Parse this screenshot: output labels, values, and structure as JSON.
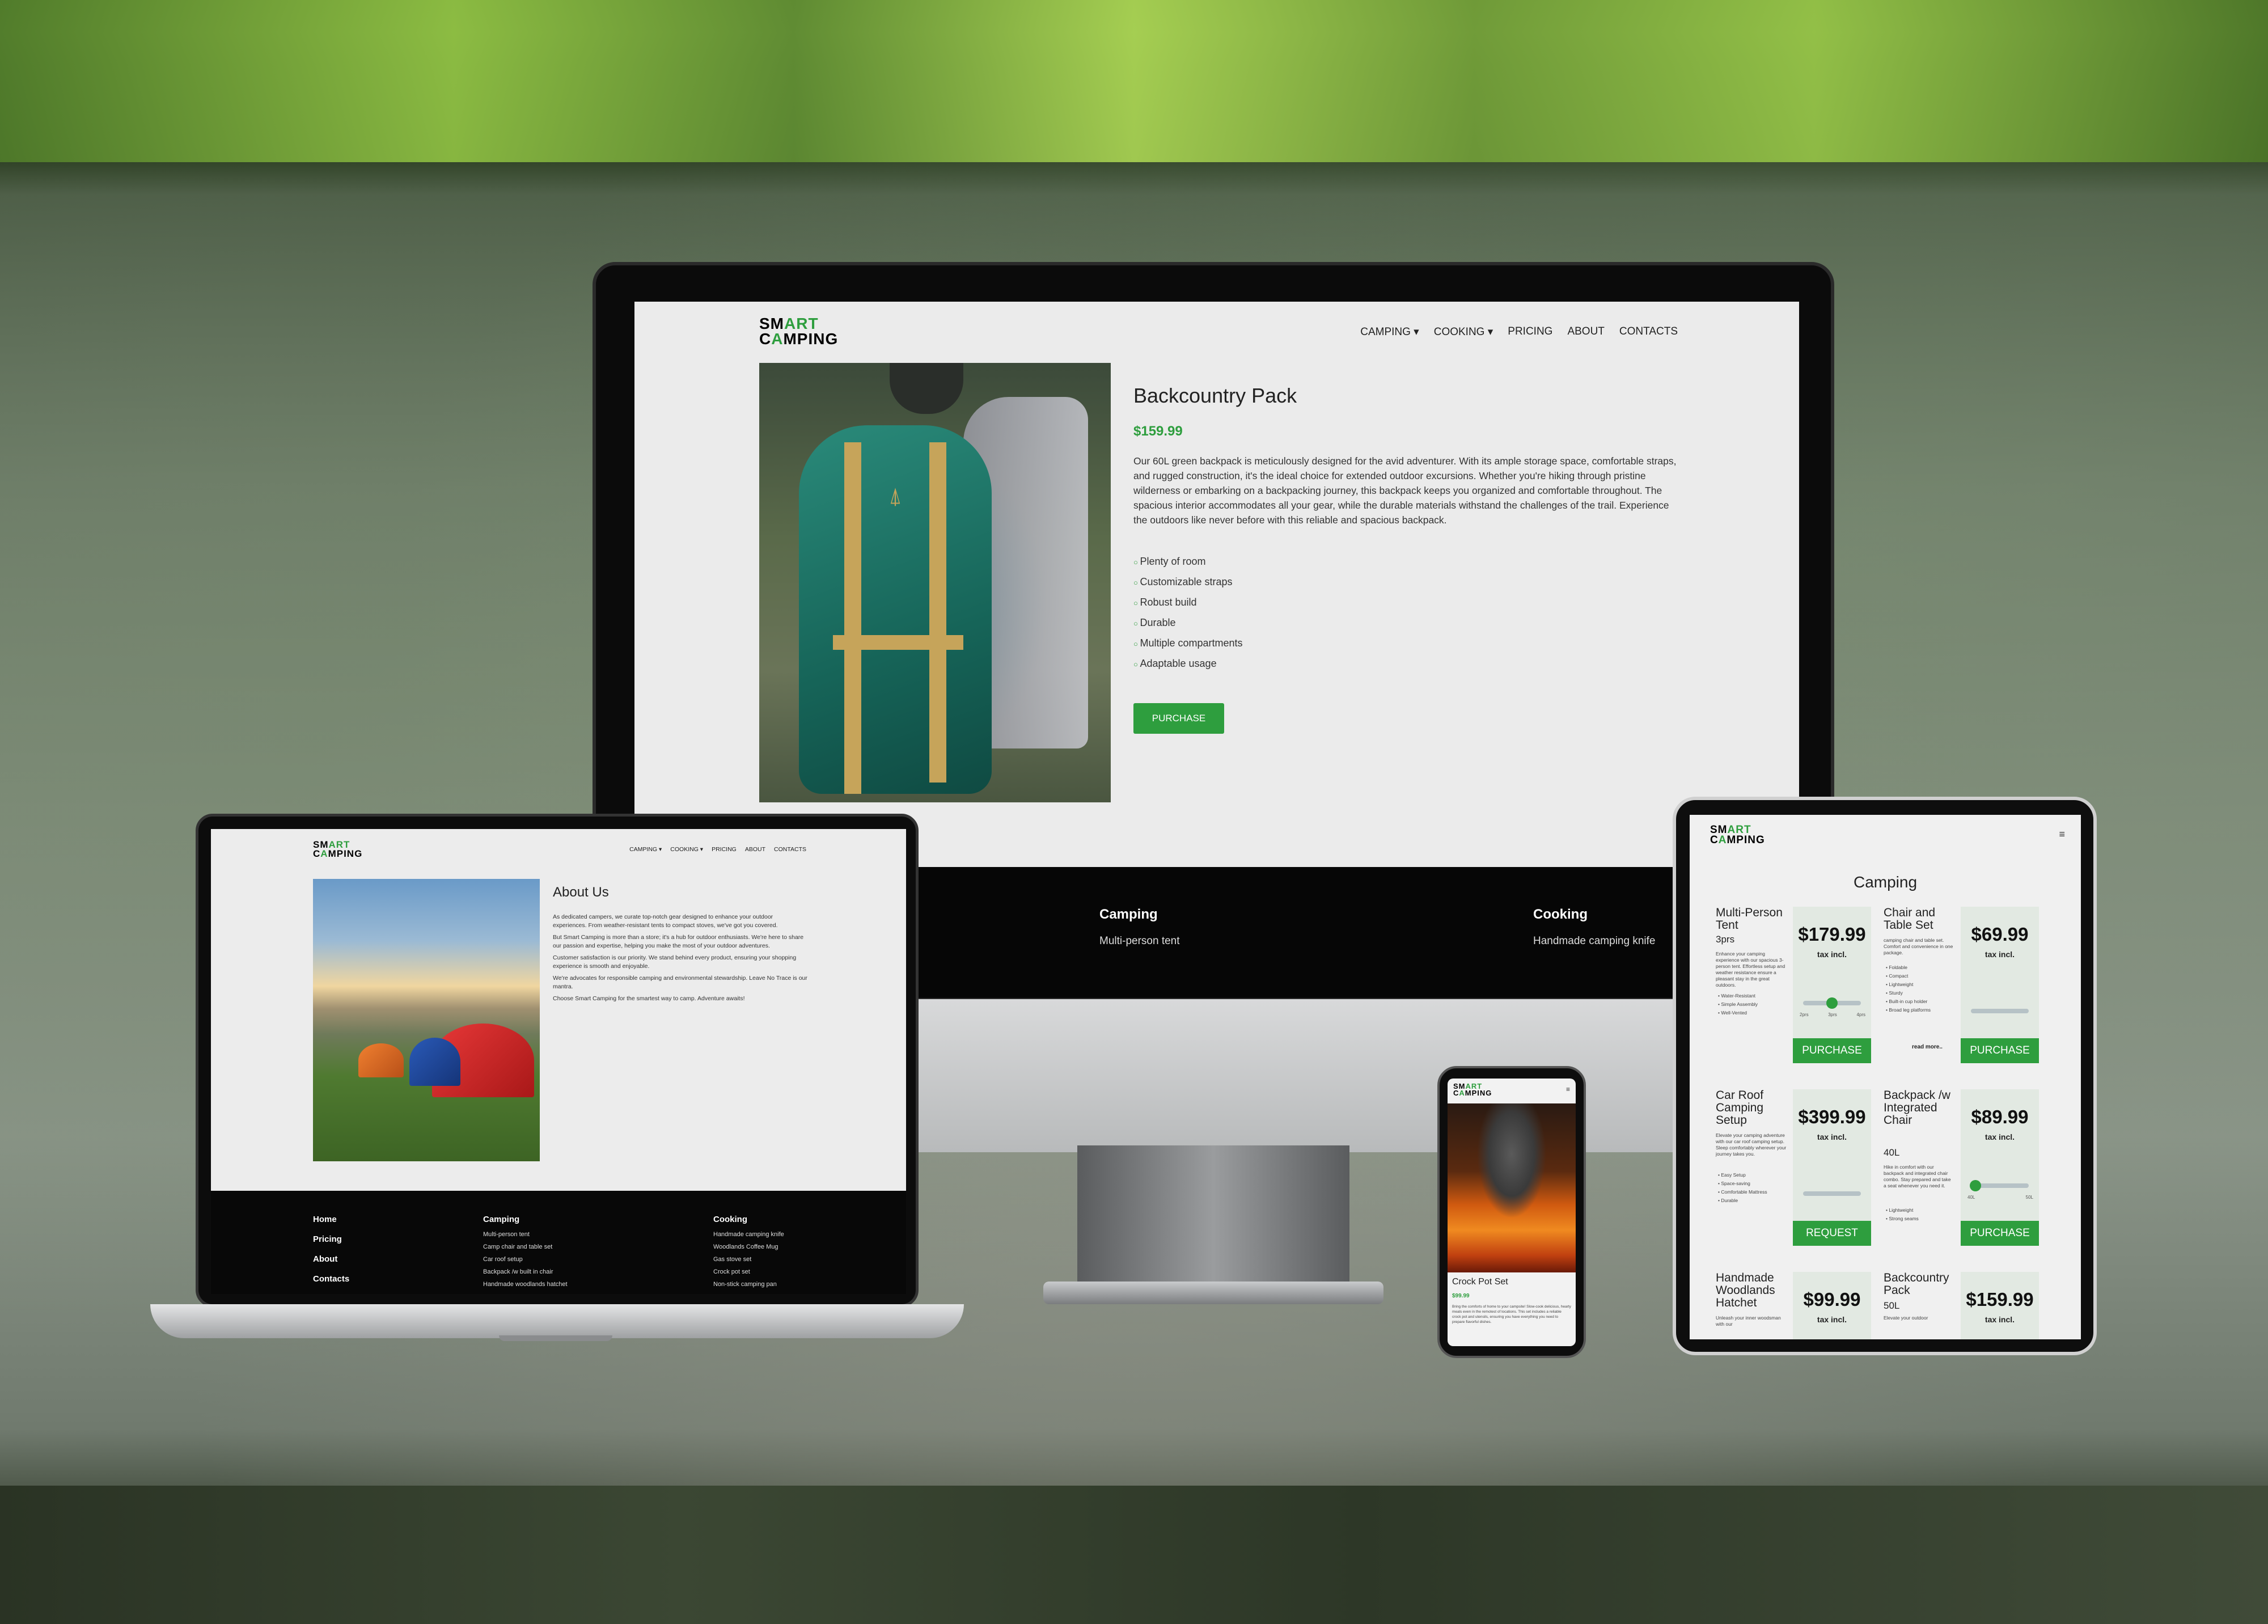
{
  "brand": {
    "logo_top_a": "SM",
    "logo_top_b": "ART",
    "logo_bot_a": "C",
    "logo_bot_b": "A",
    "logo_bot_c": "MPING",
    "accent": "#2e9e3e"
  },
  "nav": {
    "camping": "CAMPING ▾",
    "cooking": "COOKING ▾",
    "pricing": "PRICING",
    "about": "ABOUT",
    "contacts": "CONTACTS"
  },
  "monitor": {
    "title": "Backcountry Pack",
    "price": "$159.99",
    "description": "Our 60L green backpack is meticulously designed for the avid adventurer. With its ample storage space, comfortable straps, and rugged construction, it's the ideal choice for extended outdoor excursions. Whether you're hiking through pristine wilderness or embarking on a backpacking journey, this backpack keeps you organized and comfortable throughout. The spacious interior accommodates all your gear, while the durable materials withstand the challenges of the trail. Experience the outdoors like never before with this reliable and spacious backpack.",
    "features": [
      "Plenty of room",
      "Customizable straps",
      "Robust build",
      "Durable",
      "Multiple compartments",
      "Adaptable usage"
    ],
    "purchase": "PURCHASE",
    "footer": {
      "camping_h": "Camping",
      "camping_i": "Multi-person tent",
      "cooking_h": "Cooking",
      "cooking_i": "Handmade camping knife"
    }
  },
  "laptop": {
    "nav": {
      "camping": "CAMPING ▾",
      "cooking": "COOKING ▾",
      "pricing": "PRICING",
      "about": "ABOUT",
      "contacts": "CONTACTS"
    },
    "title": "About Us",
    "paragraphs": [
      "As dedicated campers, we curate top-notch gear designed to enhance your outdoor experiences. From weather-resistant tents to compact stoves, we've got you covered.",
      "But Smart Camping is more than a store; it's a hub for outdoor enthusiasts. We're here to share our passion and expertise, helping you make the most of your outdoor adventures.",
      "Customer satisfaction is our priority. We stand behind every product, ensuring your shopping experience is smooth and enjoyable.",
      "We're advocates for responsible camping and environmental stewardship. Leave No Trace is our mantra.",
      "Choose Smart Camping for the smartest way to camp. Adventure awaits!"
    ],
    "footer": {
      "links": [
        "Home",
        "Pricing",
        "About",
        "Contacts"
      ],
      "camping_h": "Camping",
      "camping_items": [
        "Multi-person tent",
        "Camp chair and table set",
        "Car roof setup",
        "Backpack /w built in chair",
        "Handmade woodlands hatchet"
      ],
      "cooking_h": "Cooking",
      "cooking_items": [
        "Handmade camping knife",
        "Woodlands Coffee Mug",
        "Gas stove set",
        "Crock pot set",
        "Non-stick camping pan"
      ]
    }
  },
  "phone": {
    "menu": "≡",
    "title": "Crock Pot Set",
    "price": "$99.99",
    "description": "Bring the comforts of home to your campsite! Slow-cook delicious, hearty meals even in the remotest of locations. This set includes a reliable crock pot and utensils, ensuring you have everything you need to prepare flavorful dishes."
  },
  "tablet": {
    "menu": "≡",
    "title": "Camping",
    "tax": "tax incl.",
    "cards": [
      {
        "name": "Multi-Person Tent",
        "sub": "3prs",
        "desc": "Enhance your camping experience with our spacious 3-person tent. Effortless setup and weather resistance ensure a pleasant stay in the great outdoors.",
        "features": [
          "Water-Resistant",
          "Simple Assembly",
          "Well-Vented"
        ],
        "price": "$179.99",
        "button": "PURCHASE",
        "slider": [
          "2prs",
          "3prs",
          "4prs"
        ],
        "slider_value": "3prs"
      },
      {
        "name": "Chair and Table Set",
        "sub": "",
        "desc": "camping chair and table set. Comfort and convenience in one package.",
        "features": [
          "Foldable",
          "Compact",
          "Lightweight",
          "Sturdy",
          "Built-in cup holder",
          "Broad leg platforms"
        ],
        "price": "$69.99",
        "button": "PURCHASE",
        "readmore": "read more.."
      },
      {
        "name": "Car Roof Camping Setup",
        "sub": "",
        "desc": "Elevate your camping adventure with our car roof camping setup. Sleep comfortably wherever your journey takes you.",
        "features": [
          "Easy Setup",
          "Space-saving",
          "Comfortable Mattress",
          "Durable"
        ],
        "price": "$399.99",
        "button": "REQUEST"
      },
      {
        "name": "Backpack /w Integrated Chair",
        "sub": "40L",
        "desc": "Hike in comfort with our backpack and integrated chair combo. Stay prepared and take a seat whenever you need it.",
        "features": [
          "Lightweight",
          "Strong seams"
        ],
        "price": "$89.99",
        "button": "PURCHASE",
        "slider": [
          "40L",
          "50L"
        ],
        "slider_value": "40L"
      },
      {
        "name": "Handmade Woodlands Hatchet",
        "sub": "",
        "desc": "Unleash your inner woodsman with our",
        "price": "$99.99"
      },
      {
        "name": "Backcountry Pack",
        "sub": "50L",
        "desc": "Elevate your outdoor",
        "price": "$159.99"
      }
    ]
  }
}
